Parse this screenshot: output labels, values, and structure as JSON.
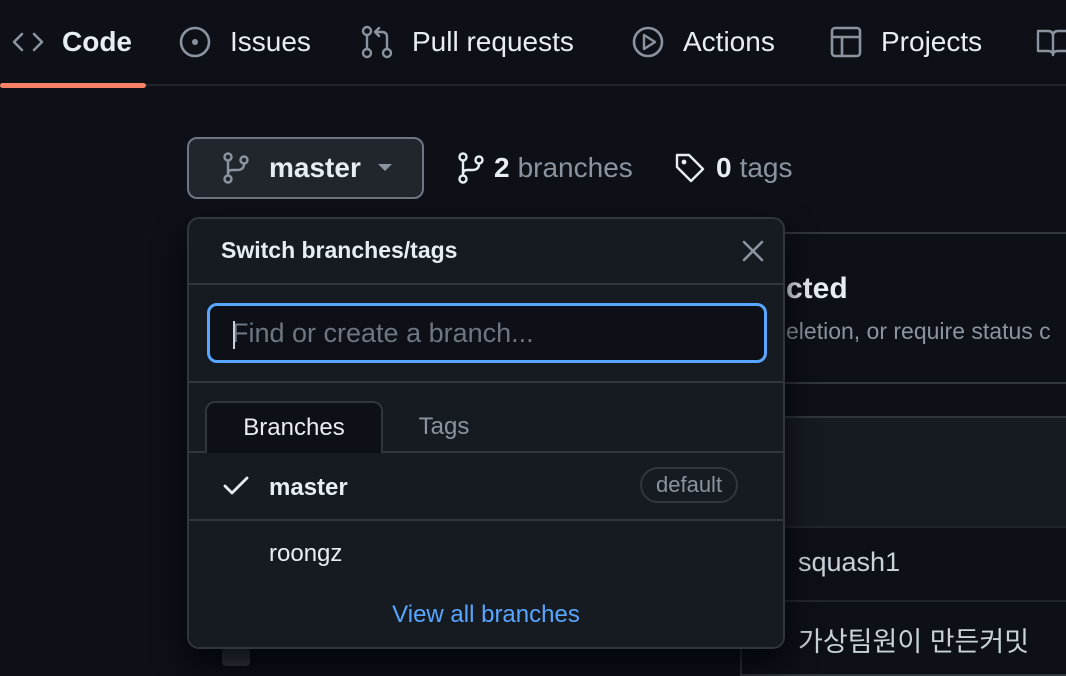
{
  "nav": {
    "tabs": [
      {
        "label": "Code",
        "icon": "code-icon",
        "active": true
      },
      {
        "label": "Issues",
        "icon": "issue-opened-icon"
      },
      {
        "label": "Pull requests",
        "icon": "git-pull-request-icon"
      },
      {
        "label": "Actions",
        "icon": "play-icon"
      },
      {
        "label": "Projects",
        "icon": "table-icon"
      },
      {
        "label": "",
        "icon": "book-icon"
      }
    ],
    "active_color": "#f78166"
  },
  "branch_selector": {
    "current": "master",
    "branch_count": "2",
    "branch_word": "branches",
    "tag_count": "0",
    "tag_word": "tags"
  },
  "background": {
    "protect_title": "cted",
    "protect_sub": "eletion, or require status c",
    "commits": [
      "squash1",
      "가상팀원이 만든커밋"
    ]
  },
  "dropdown": {
    "title": "Switch branches/tags",
    "filter_placeholder": "Find or create a branch...",
    "filter_value": "",
    "tabs": {
      "branches": "Branches",
      "tags": "Tags",
      "selected": "Branches"
    },
    "items": [
      {
        "name": "master",
        "badge": "default",
        "checked": true
      },
      {
        "name": "roongz",
        "checked": false
      }
    ],
    "view_all": "View all branches"
  },
  "colors": {
    "bg": "#0d1117",
    "panel": "#161b22",
    "border": "#30363d",
    "link": "#58a6ff",
    "focus": "#58a6ff"
  }
}
